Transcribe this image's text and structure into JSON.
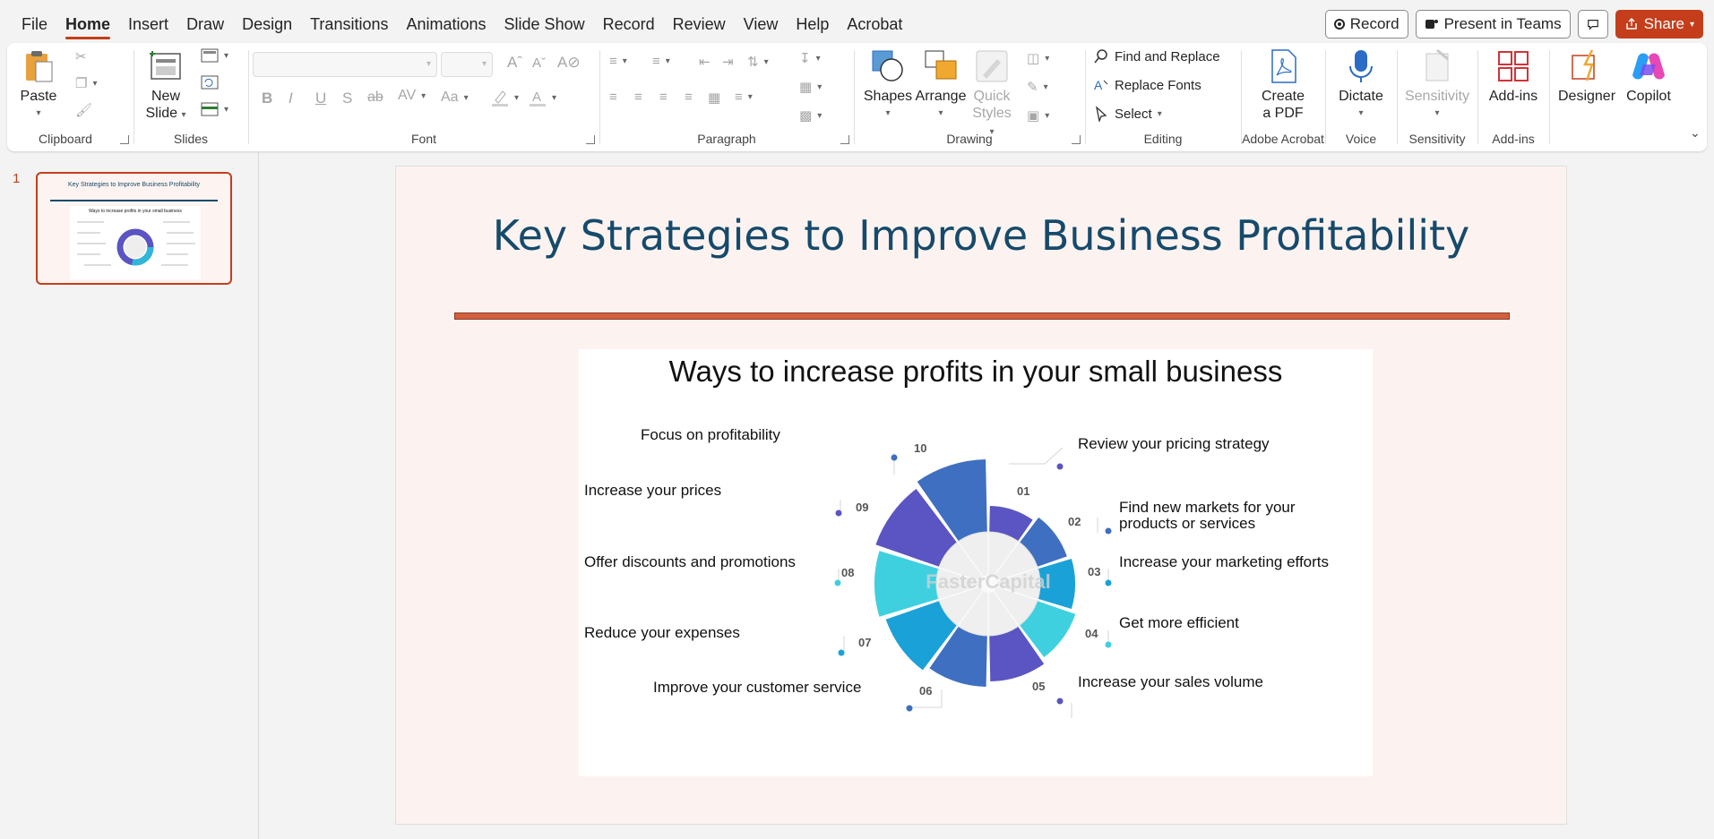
{
  "menu": {
    "tabs": [
      "File",
      "Home",
      "Insert",
      "Draw",
      "Design",
      "Transitions",
      "Animations",
      "Slide Show",
      "Record",
      "Review",
      "View",
      "Help",
      "Acrobat"
    ],
    "active": "Home",
    "record_label": "Record",
    "present_label": "Present in Teams",
    "share_label": "Share"
  },
  "ribbon": {
    "clipboard": {
      "paste": "Paste",
      "label": "Clipboard"
    },
    "slides": {
      "new_slide_1": "New",
      "new_slide_2": "Slide",
      "label": "Slides"
    },
    "font": {
      "label": "Font"
    },
    "paragraph": {
      "label": "Paragraph"
    },
    "drawing": {
      "shapes": "Shapes",
      "arrange": "Arrange",
      "quick_styles_1": "Quick",
      "quick_styles_2": "Styles",
      "label": "Drawing"
    },
    "editing": {
      "find_replace": "Find and Replace",
      "replace_fonts": "Replace Fonts",
      "select": "Select",
      "label": "Editing"
    },
    "acrobat": {
      "create_1": "Create",
      "create_2": "a PDF",
      "label": "Adobe Acrobat"
    },
    "voice": {
      "dictate": "Dictate",
      "label": "Voice"
    },
    "sensitivity": {
      "button": "Sensitivity",
      "label": "Sensitivity"
    },
    "addins": {
      "button": "Add-ins",
      "label": "Add-ins"
    },
    "designer": "Designer",
    "copilot": "Copilot"
  },
  "thumbnail": {
    "number": "1",
    "title": "Key Strategies to Improve Business Profitability",
    "subtitle": "Ways to increase profits in your small business"
  },
  "slide": {
    "title": "Key Strategies to Improve Business Profitability",
    "infographic_title": "Ways to increase profits in your small business",
    "watermark": "FasterCapital",
    "items": [
      {
        "num": "01",
        "label": "Review your pricing strategy"
      },
      {
        "num": "02",
        "label": "Find new markets for your products or services"
      },
      {
        "num": "03",
        "label": "Increase your marketing efforts"
      },
      {
        "num": "04",
        "label": "Get more efficient"
      },
      {
        "num": "05",
        "label": "Increase your sales volume"
      },
      {
        "num": "06",
        "label": "Improve your customer service"
      },
      {
        "num": "07",
        "label": "Reduce your expenses"
      },
      {
        "num": "08",
        "label": "Offer discounts and promotions"
      },
      {
        "num": "09",
        "label": "Increase your prices"
      },
      {
        "num": "10",
        "label": "Focus on profitability"
      }
    ]
  },
  "colors": {
    "accent": "#c43e1c",
    "title": "#164a6b",
    "rule": "#d2603f"
  }
}
